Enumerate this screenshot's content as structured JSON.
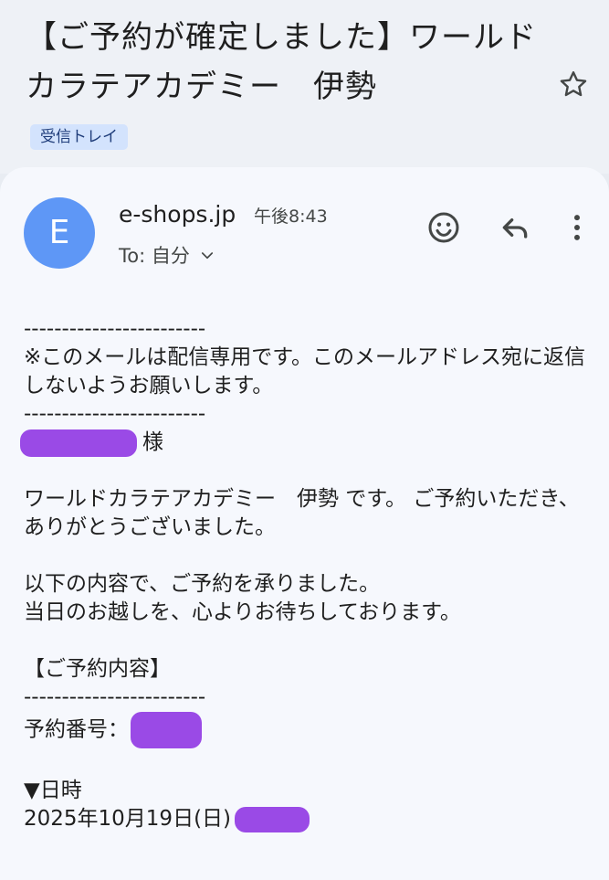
{
  "email": {
    "subject": "【ご予約が確定しました】ワールドカラテアカデミー　伊勢",
    "label": "受信トレイ",
    "sender": "e-shops.jp",
    "time": "午後8:43",
    "recipient": "To: 自分",
    "avatar_letter": "E"
  },
  "body": {
    "separator": "------------------------",
    "notice": "※このメールは配信専用です。このメールアドレス宛に返信しないようお願いします。",
    "honorific": "様",
    "greeting": "ワールドカラテアカデミー　伊勢 です。 ご予約いただき、ありがとうございました。",
    "confirm_line1": "以下の内容で、ご予約を承りました。",
    "confirm_line2": "当日のお越しを、心よりお待ちしております。",
    "section_title": "【ご予約内容】",
    "booking_number_label": "予約番号：",
    "datetime_label": "▼日時",
    "date_value": "2025年10月19日(日)"
  },
  "icons": {
    "star": "star-outline-icon",
    "emoji": "emoji-reaction-icon",
    "reply": "reply-icon",
    "more": "more-vert-icon",
    "chevron": "chevron-down-icon"
  },
  "colors": {
    "avatar": "#5e97f6",
    "label_chip": "#d3e3fd",
    "redaction": "#8a2be2"
  }
}
